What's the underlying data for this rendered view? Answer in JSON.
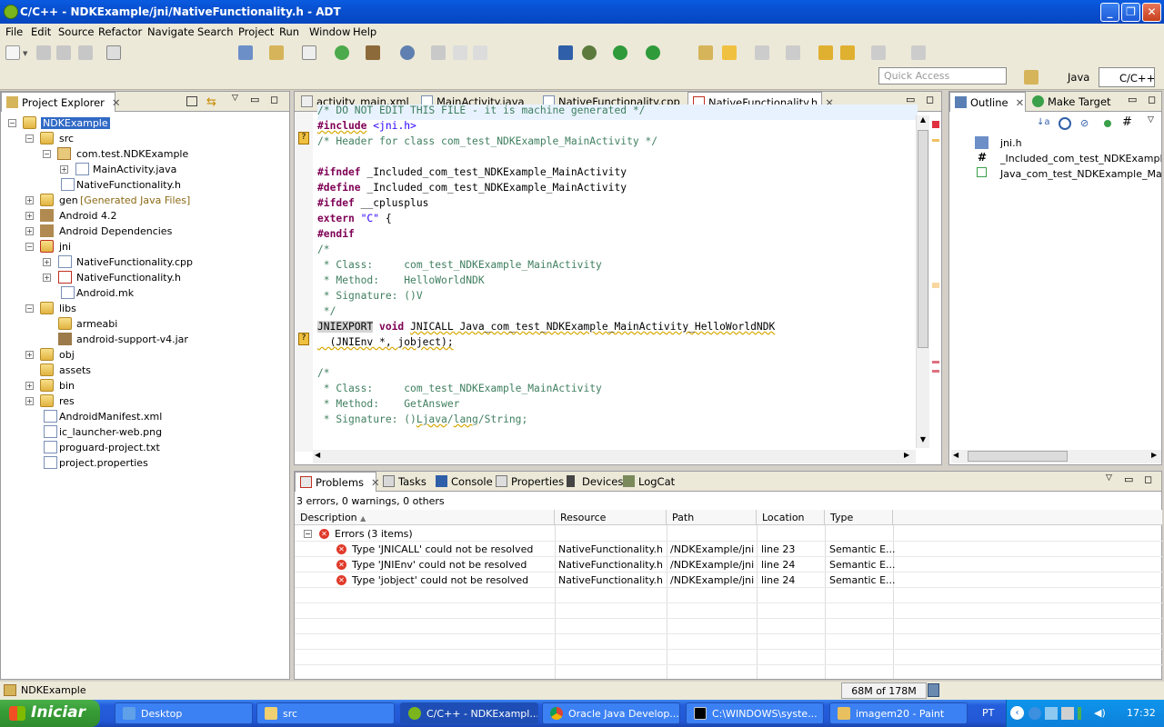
{
  "window": {
    "title": "C/C++ - NDKExample/jni/NativeFunctionality.h - ADT",
    "min": "_",
    "max": "❐",
    "close": "✕"
  },
  "menu": [
    "File",
    "Edit",
    "Source",
    "Refactor",
    "Navigate",
    "Search",
    "Project",
    "Run",
    "Window",
    "Help"
  ],
  "quick_access": {
    "placeholder": "Quick Access"
  },
  "perspectives": [
    "Java",
    "C/C++"
  ],
  "project_explorer": {
    "title": "Project Explorer",
    "tree": [
      {
        "label": "NDKExample",
        "selected": true
      },
      {
        "label": "src"
      },
      {
        "label": "com.test.NDKExample"
      },
      {
        "label": "MainActivity.java"
      },
      {
        "label": "NativeFunctionality.h"
      },
      {
        "label": "gen",
        "extra": "[Generated Java Files]"
      },
      {
        "label": "Android 4.2"
      },
      {
        "label": "Android Dependencies"
      },
      {
        "label": "jni"
      },
      {
        "label": "NativeFunctionality.cpp"
      },
      {
        "label": "NativeFunctionality.h"
      },
      {
        "label": "Android.mk"
      },
      {
        "label": "libs"
      },
      {
        "label": "armeabi"
      },
      {
        "label": "android-support-v4.jar"
      },
      {
        "label": "obj"
      },
      {
        "label": "assets"
      },
      {
        "label": "bin"
      },
      {
        "label": "res"
      },
      {
        "label": "AndroidManifest.xml"
      },
      {
        "label": "ic_launcher-web.png"
      },
      {
        "label": "proguard-project.txt"
      },
      {
        "label": "project.properties"
      }
    ]
  },
  "editor": {
    "tabs": [
      "activity_main.xml",
      "MainActivity.java",
      "NativeFunctionality.cpp",
      "NativeFunctionality.h"
    ],
    "active_tab": 3
  },
  "outline": {
    "tabs": [
      "Outline",
      "Make Target"
    ],
    "items": [
      "jni.h",
      "_Included_com_test_NDKExample_M",
      "Java_com_test_NDKExample_MainAc"
    ]
  },
  "problems": {
    "tabs": [
      "Problems",
      "Tasks",
      "Console",
      "Properties",
      "Devices",
      "LogCat"
    ],
    "summary": "3 errors, 0 warnings, 0 others",
    "columns": [
      "Description",
      "Resource",
      "Path",
      "Location",
      "Type"
    ],
    "group": "Errors (3 items)",
    "rows": [
      {
        "desc": "Type 'JNICALL' could not be resolved",
        "resource": "NativeFunctionality.h",
        "path": "/NDKExample/jni",
        "location": "line 23",
        "type": "Semantic E..."
      },
      {
        "desc": "Type 'JNIEnv' could not be resolved",
        "resource": "NativeFunctionality.h",
        "path": "/NDKExample/jni",
        "location": "line 24",
        "type": "Semantic E..."
      },
      {
        "desc": "Type 'jobject' could not be resolved",
        "resource": "NativeFunctionality.h",
        "path": "/NDKExample/jni",
        "location": "line 24",
        "type": "Semantic E..."
      }
    ]
  },
  "status": {
    "selection": "NDKExample",
    "memory": "68M of 178M"
  },
  "taskbar": {
    "start": "Iniciar",
    "tasks": [
      "Desktop",
      "src",
      "C/C++ - NDKExampl...",
      "Oracle Java Develop...",
      "C:\\WINDOWS\\syste...",
      "imagem20 - Paint"
    ],
    "lang": "PT",
    "time": "17:32"
  },
  "colors": {
    "xp_blue": "#0a5be0",
    "start_green": "#379d36",
    "comment": "#3f7f5f",
    "keyword": "#7f0055",
    "string": "#2a00ff"
  }
}
